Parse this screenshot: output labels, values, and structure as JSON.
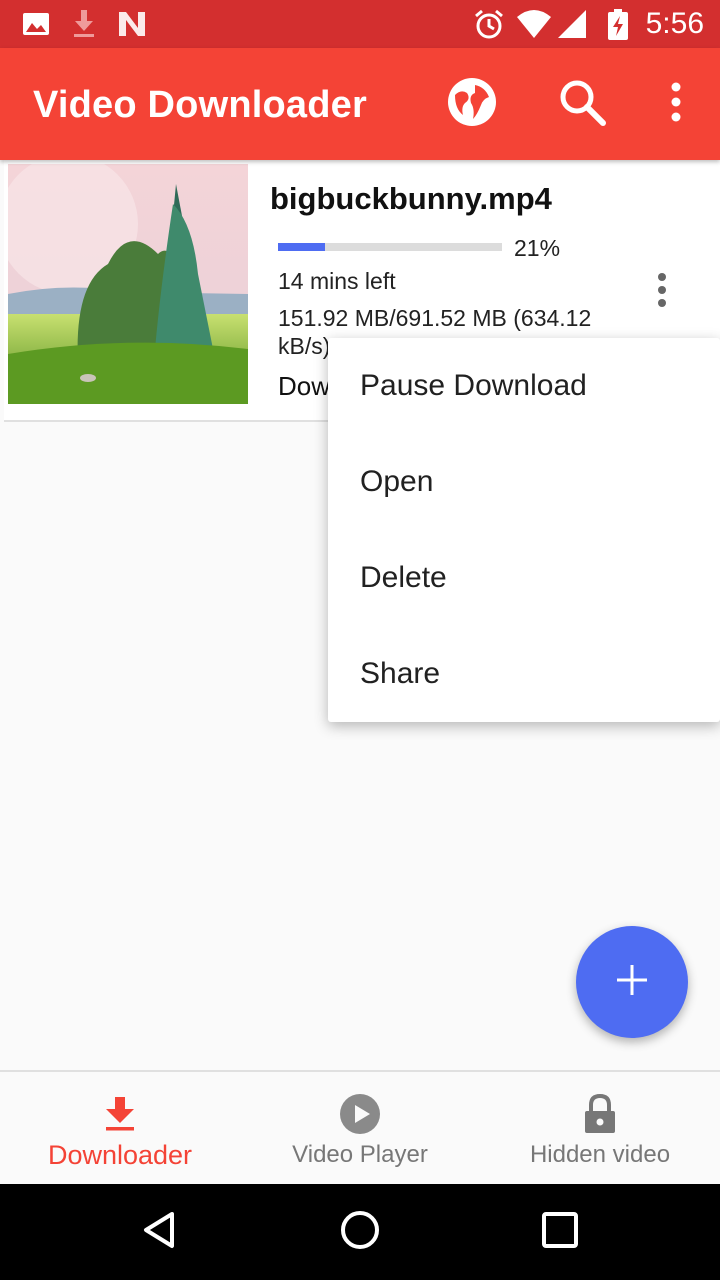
{
  "status_bar": {
    "time": "5:56",
    "icons": [
      "image-icon",
      "download-icon",
      "n-icon",
      "alarm-icon",
      "wifi-icon",
      "signal-icon",
      "battery-charging-icon"
    ]
  },
  "app_bar": {
    "title": "Video Downloader",
    "icons": [
      "globe-icon",
      "search-icon",
      "more-vert-icon"
    ],
    "color": "#f44336"
  },
  "download_item": {
    "filename": "bigbuckbunny.mp4",
    "progress": 0.21,
    "percent_label": "21%",
    "time_left": "14 mins left",
    "size_info": "151.92 MB/691.52 MB (634.12 kB/s)",
    "status_text": "Dow"
  },
  "popup_menu": {
    "items": [
      "Pause Download",
      "Open",
      "Delete",
      "Share"
    ]
  },
  "fab": {
    "icon": "plus-icon",
    "color": "#4e6cf2"
  },
  "bottom_nav": {
    "items": [
      {
        "label": "Downloader",
        "icon": "download-icon",
        "active": true
      },
      {
        "label": "Video Player",
        "icon": "play-circle-icon",
        "active": false
      },
      {
        "label": "Hidden video",
        "icon": "lock-icon",
        "active": false
      }
    ],
    "active_color": "#f44336"
  },
  "system_nav": {
    "icons": [
      "back-icon",
      "home-icon",
      "recents-icon"
    ]
  }
}
